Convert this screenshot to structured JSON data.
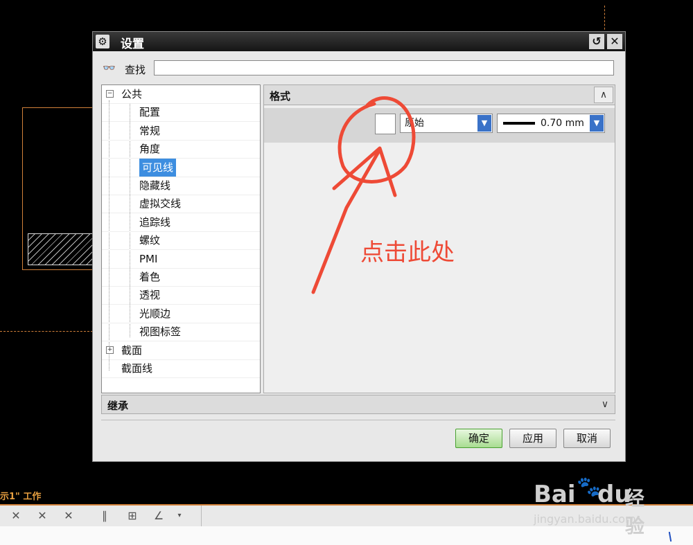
{
  "dialog": {
    "title": "设置",
    "search_label": "查找",
    "search_value": ""
  },
  "tree": {
    "items": [
      {
        "label": "公共",
        "expander": "−"
      },
      {
        "label": "配置"
      },
      {
        "label": "常规"
      },
      {
        "label": "角度"
      },
      {
        "label": "可见线",
        "selected": true
      },
      {
        "label": "隐藏线"
      },
      {
        "label": "虚拟交线"
      },
      {
        "label": "追踪线"
      },
      {
        "label": "螺纹"
      },
      {
        "label": "PMI"
      },
      {
        "label": "着色"
      },
      {
        "label": "透视"
      },
      {
        "label": "光顺边"
      },
      {
        "label": "视图标签"
      },
      {
        "label": "截面",
        "expander": "+"
      },
      {
        "label": "截面线"
      }
    ]
  },
  "format_panel": {
    "title": "格式",
    "line_font": "原始",
    "line_width": "0.70 mm",
    "collapse_symbol": "∧"
  },
  "inherit": {
    "title": "继承",
    "expand_symbol": "∨"
  },
  "buttons": {
    "ok": "确定",
    "apply": "应用",
    "cancel": "取消"
  },
  "annotation": {
    "text": "点击此处",
    "color": "#ee4a36"
  },
  "background": {
    "work_label": "示1\" 工作"
  },
  "watermark": {
    "brand_left": "Bai",
    "brand_right": "du",
    "brand_cn": "经验",
    "url": "jingyan.baidu.com"
  },
  "colors": {
    "selection": "#3d8ee0",
    "ok_button": "#a8dc90",
    "cad_orange": "#d2813a"
  }
}
